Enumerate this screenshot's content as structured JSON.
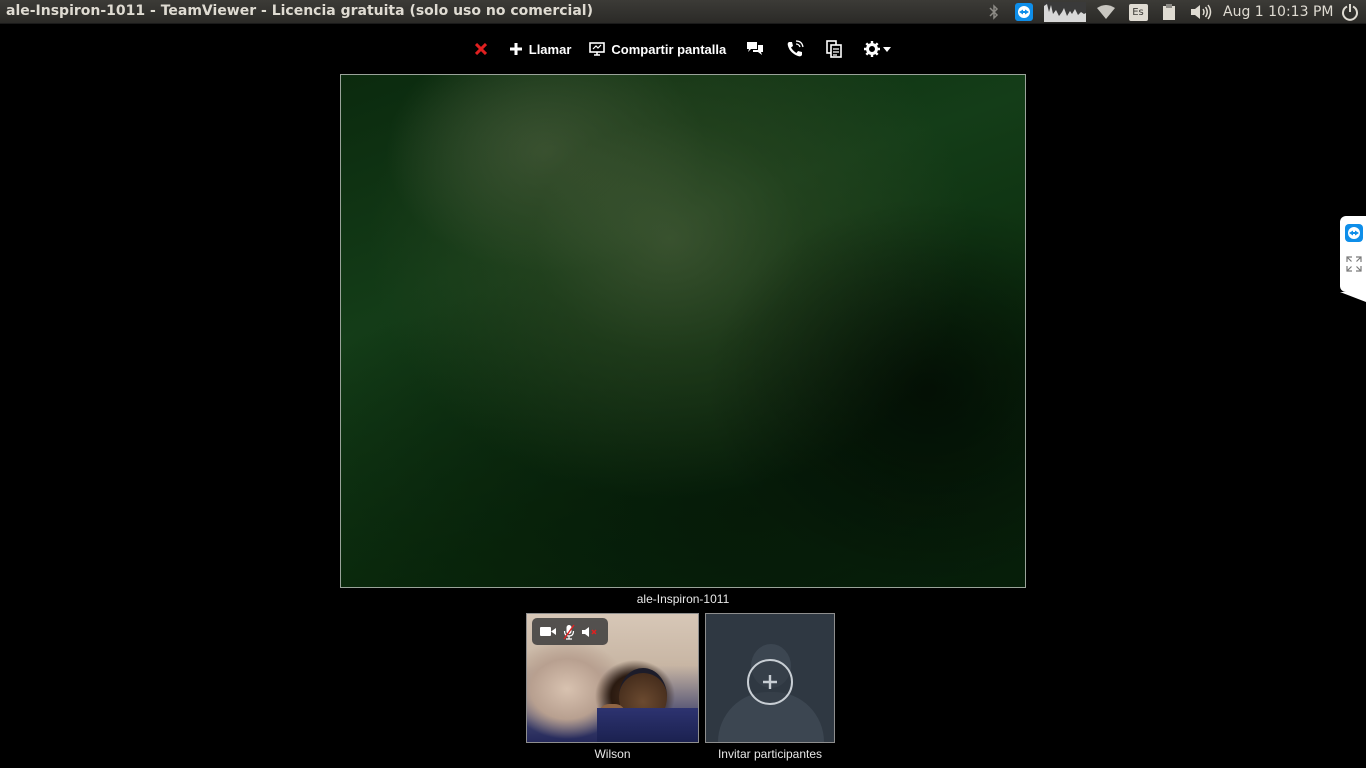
{
  "panel": {
    "window_title": "ale-Inspiron-1011 - TeamViewer - Licencia gratuita (solo uso no comercial)",
    "keyboard_layout": "Es",
    "clock": "Aug  1 10:13 PM"
  },
  "toolbar": {
    "call_label": "Llamar",
    "share_label": "Compartir pantalla"
  },
  "main_video": {
    "participant_name": "ale-Inspiron-1011"
  },
  "participants": [
    {
      "name": "Wilson"
    },
    {
      "name": "Invitar participantes"
    }
  ],
  "colors": {
    "panel_bg": "#3c3b37",
    "close_red": "#e02020",
    "accent_blue": "#0e8ee9",
    "invite_bg": "#2f3842"
  },
  "icons": {
    "tray": [
      "bluetooth-icon",
      "teamviewer-tray-icon",
      "system-monitor-icon",
      "wifi-icon",
      "keyboard-layout-icon",
      "clipboard-icon",
      "volume-icon",
      "power-icon"
    ],
    "toolbar": [
      "close-icon",
      "plus-icon",
      "screen-share-icon",
      "chat-icon",
      "phone-icon",
      "files-icon",
      "gear-icon"
    ],
    "media": [
      "camera-icon",
      "microphone-muted-icon",
      "speaker-muted-icon"
    ]
  }
}
